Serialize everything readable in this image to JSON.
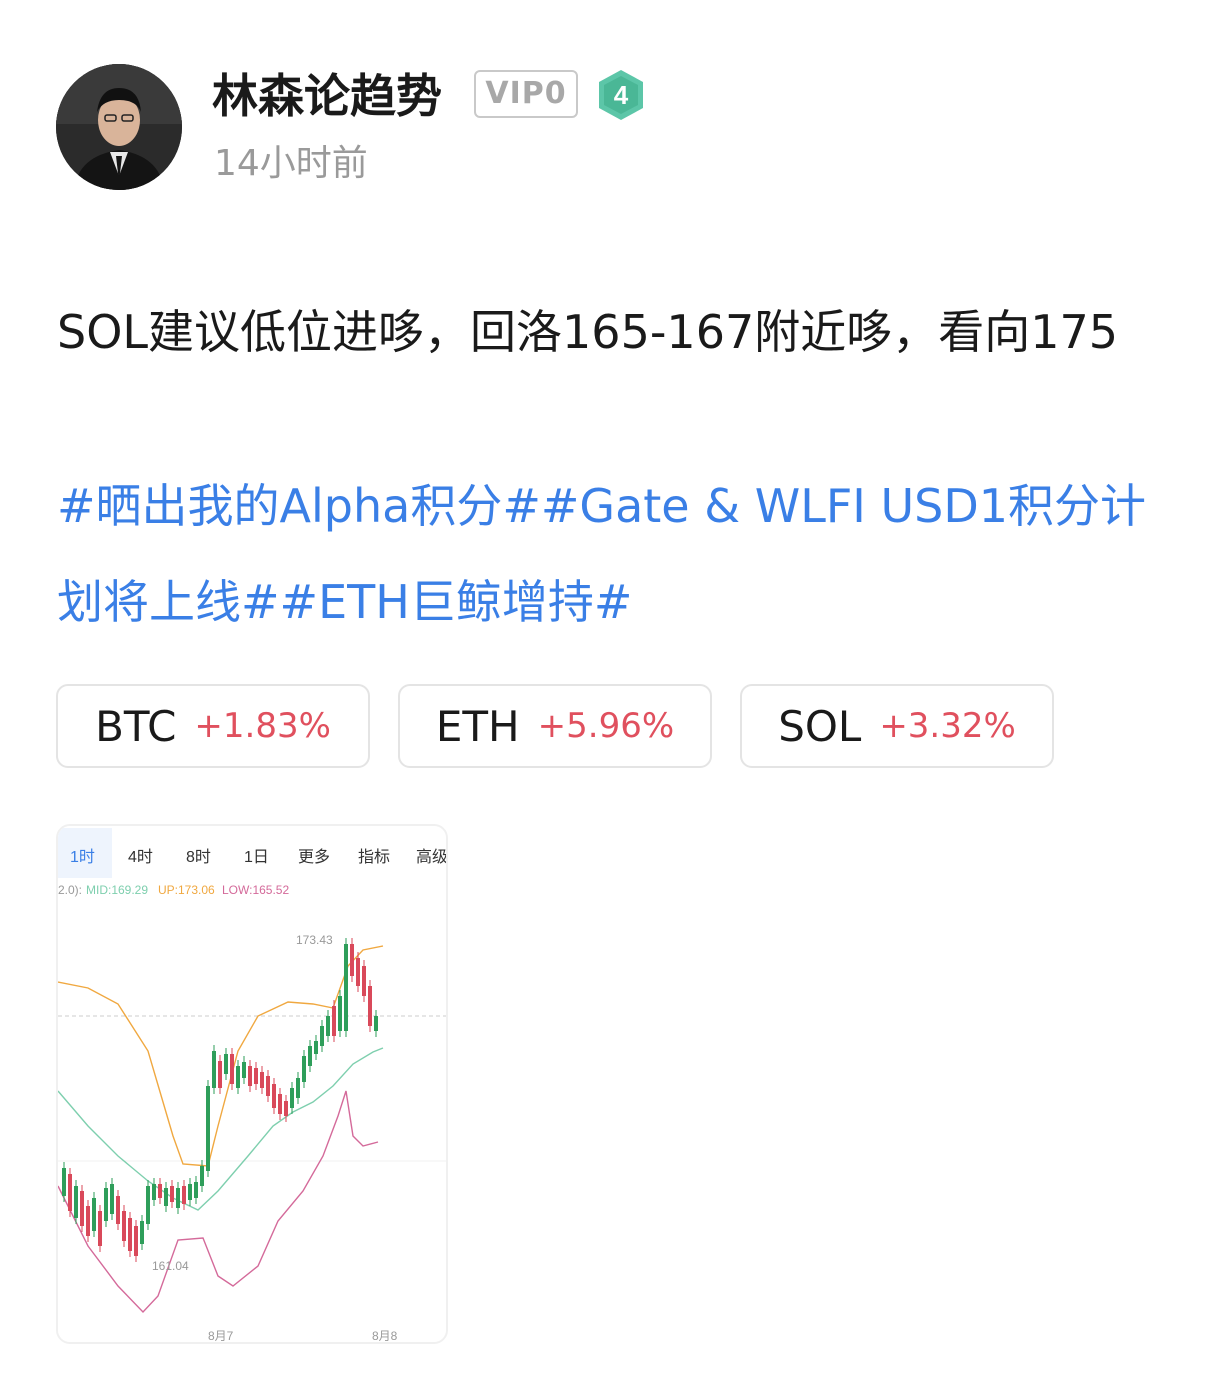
{
  "author": {
    "name": "林森论趋势",
    "vip_label": "VIP0",
    "level": "4",
    "time_ago": "14小时前"
  },
  "post": {
    "text": "SOL建议低位进哆，回洛165-167附近哆，看向175",
    "hashtags": "#晒出我的Alpha积分##Gate & WLFI USD1积分计划将上线##ETH巨鲸增持#"
  },
  "tickers": [
    {
      "symbol": "BTC",
      "change": "+1.83%"
    },
    {
      "symbol": "ETH",
      "change": "+5.96%"
    },
    {
      "symbol": "SOL",
      "change": "+3.32%"
    }
  ],
  "chart_image": {
    "tabs": [
      "1时",
      "4时",
      "8时",
      "1日",
      "更多",
      "指标",
      "高级"
    ],
    "active_tab": "1时",
    "indicator_label": "2.0): ",
    "mid_label": "MID:169.29",
    "up_label": "UP:173.06",
    "low_label": "LOW:165.52",
    "high_price_label": "173.43",
    "low_price_label": "161.04",
    "x_labels": [
      "8月7",
      "8月8"
    ],
    "colors": {
      "active_tab": "#3a7fe6",
      "up_band": "#f0a840",
      "mid_band": "#7ecfae",
      "low_band": "#d46a9a",
      "bull_candle": "#2e9e5a",
      "bear_candle": "#d9495a"
    }
  },
  "colors": {
    "hashtag": "#3a7fe6",
    "change_positive": "#e0505e",
    "timestamp": "#9a9a9a",
    "level_badge": "#5cc6a8"
  }
}
